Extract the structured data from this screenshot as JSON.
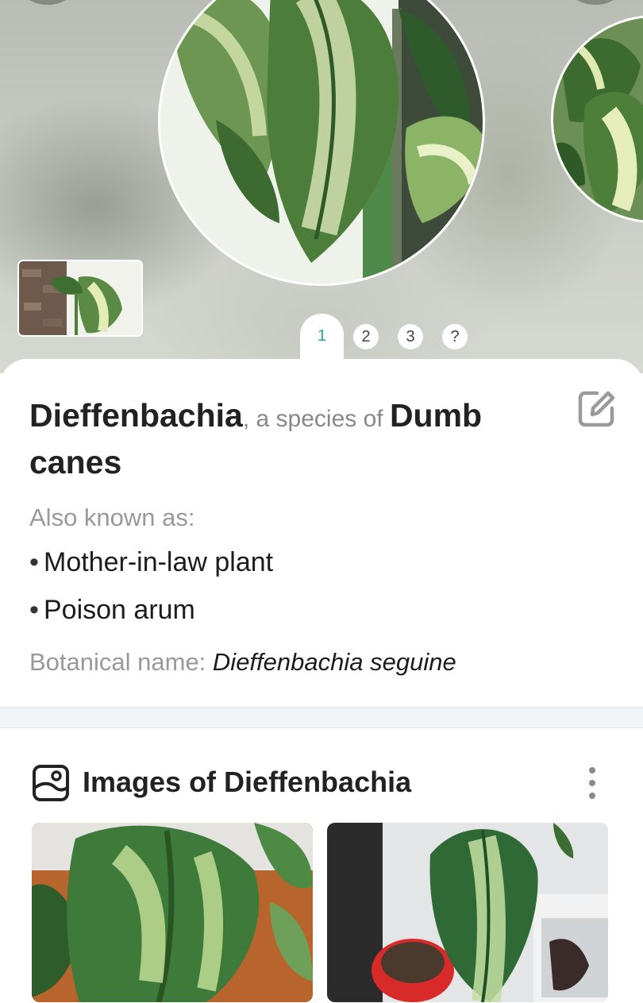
{
  "pager": {
    "tabs": [
      "1",
      "2",
      "3",
      "?"
    ]
  },
  "species": {
    "common_name": "Dieffenbachia",
    "connector": ", a species of ",
    "group": "Dumb canes"
  },
  "also_known": {
    "label": "Also known as:",
    "names": [
      "Mother-in-law plant",
      "Poison arum"
    ]
  },
  "botanical": {
    "label": "Botanical name: ",
    "value": "Dieffenbachia seguine"
  },
  "images_section": {
    "title": "Images of Dieffenbachia"
  },
  "icons": {
    "edit": "edit-icon",
    "gallery": "image-gallery-icon",
    "more": "more-vertical-icon"
  },
  "colors": {
    "accent": "#2aa388",
    "text_primary": "#222222",
    "text_secondary": "#999999",
    "divider": "#f2f5f8"
  }
}
